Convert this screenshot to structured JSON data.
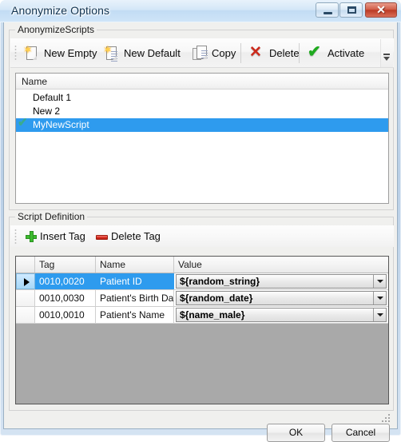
{
  "window": {
    "title": "Anonymize Options",
    "caption_buttons": {
      "minimize": "minimize-icon",
      "maximize": "maximize-icon",
      "close": "✕"
    }
  },
  "scripts_group": {
    "label": "AnonymizeScripts",
    "toolbar": {
      "items": [
        {
          "label": "New Empty",
          "icon": "new-page-star-icon"
        },
        {
          "label": "New Default",
          "icon": "page-lines-star-icon"
        },
        {
          "label": "Copy",
          "icon": "copy-pages-icon"
        },
        {
          "label": "Delete",
          "icon": "red-x-icon"
        },
        {
          "label": "Activate",
          "icon": "green-check-icon"
        }
      ],
      "overflow": "toolbar-overflow-icon"
    },
    "list": {
      "column_header": "Name",
      "rows": [
        {
          "name": "Default 1",
          "active": false,
          "selected": false
        },
        {
          "name": "New 2",
          "active": false,
          "selected": false
        },
        {
          "name": "MyNewScript",
          "active": true,
          "selected": true
        }
      ]
    }
  },
  "definition_group": {
    "label": "Script Definition",
    "toolbar": {
      "items": [
        {
          "label": "Insert Tag",
          "icon": "green-plus-icon"
        },
        {
          "label": "Delete Tag",
          "icon": "red-minus-icon"
        }
      ]
    },
    "grid": {
      "columns": [
        "",
        "Tag",
        "Name",
        "Value"
      ],
      "rows": [
        {
          "tag": "0010,0020",
          "name": "Patient ID",
          "value": "${random_string}",
          "current": true,
          "selected": true
        },
        {
          "tag": "0010,0030",
          "name": "Patient's Birth Date",
          "value": "${random_date}",
          "current": false,
          "selected": false
        },
        {
          "tag": "0010,0010",
          "name": "Patient's Name",
          "value": "${name_male}",
          "current": false,
          "selected": false
        }
      ]
    }
  },
  "footer": {
    "ok_label": "OK",
    "cancel_label": "Cancel"
  },
  "colors": {
    "selection_blue": "#2e9bee",
    "grid_background": "#a9a9a9",
    "dialog_face": "#f0f0ee",
    "close_red": "#bb3a24"
  }
}
